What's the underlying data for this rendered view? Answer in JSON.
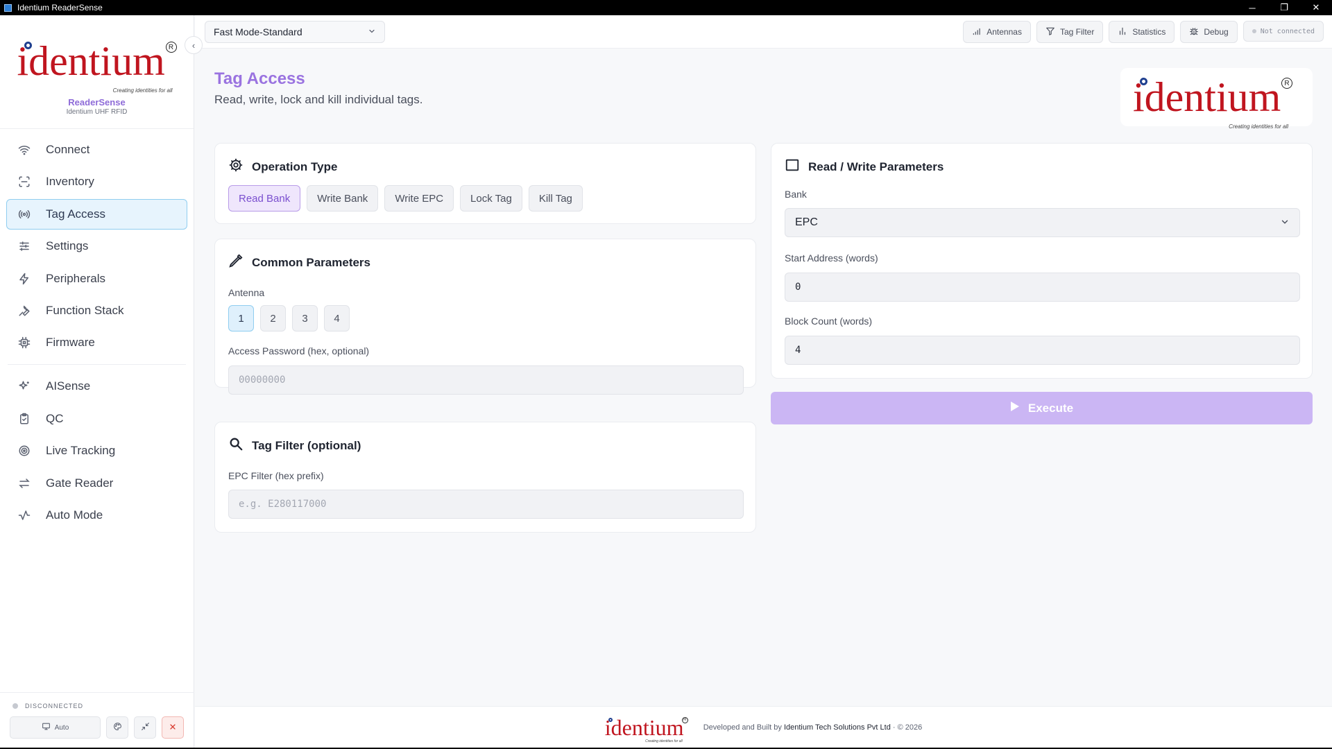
{
  "window": {
    "title": "Identium ReaderSense",
    "minimize": "─",
    "maximize": "❐",
    "close": "✕"
  },
  "sidebar": {
    "logo_text": "identium",
    "logo_tagline": "Creating identities for all",
    "logo_reg": "R",
    "app_name": "ReaderSense",
    "app_sub": "Identium UHF RFID",
    "items": [
      {
        "label": "Connect",
        "icon": "wifi-icon"
      },
      {
        "label": "Inventory",
        "icon": "scan-icon"
      },
      {
        "label": "Tag Access",
        "icon": "broadcast-icon",
        "active": true
      },
      {
        "label": "Settings",
        "icon": "sliders-icon"
      },
      {
        "label": "Peripherals",
        "icon": "bolt-icon"
      },
      {
        "label": "Function Stack",
        "icon": "wrench-icon"
      },
      {
        "label": "Firmware",
        "icon": "chip-icon"
      }
    ],
    "items2": [
      {
        "label": "AISense",
        "icon": "sparkle-icon"
      },
      {
        "label": "QC",
        "icon": "clipboard-icon"
      },
      {
        "label": "Live Tracking",
        "icon": "target-icon"
      },
      {
        "label": "Gate Reader",
        "icon": "swap-icon"
      },
      {
        "label": "Auto Mode",
        "icon": "activity-icon"
      }
    ],
    "status": "DISCONNECTED",
    "auto_label": "Auto"
  },
  "topbar": {
    "mode": "Fast Mode-Standard",
    "buttons": {
      "antennas": "Antennas",
      "tag_filter": "Tag Filter",
      "statistics": "Statistics",
      "debug": "Debug"
    },
    "connection": "Not connected"
  },
  "page": {
    "title": "Tag Access",
    "subtitle": "Read, write, lock and kill individual tags."
  },
  "operation": {
    "title": "Operation Type",
    "options": [
      "Read Bank",
      "Write Bank",
      "Write EPC",
      "Lock Tag",
      "Kill Tag"
    ],
    "selected": "Read Bank"
  },
  "common": {
    "title": "Common Parameters",
    "antenna_label": "Antenna",
    "antennas": [
      "1",
      "2",
      "3",
      "4"
    ],
    "selected_antenna": "1",
    "password_label": "Access Password (hex, optional)",
    "password_placeholder": "00000000"
  },
  "filter": {
    "title": "Tag Filter (optional)",
    "epc_label": "EPC Filter (hex prefix)",
    "epc_placeholder": "e.g. E280117000"
  },
  "rw": {
    "title": "Read / Write Parameters",
    "bank_label": "Bank",
    "bank_value": "EPC",
    "start_label": "Start Address (words)",
    "start_value": "0",
    "count_label": "Block Count (words)",
    "count_value": "4"
  },
  "execute_label": "Execute",
  "footer": {
    "prefix": "Developed and Built by",
    "company": "Identium Tech Solutions Pvt Ltd",
    "suffix": "· © 2026"
  },
  "colors": {
    "accent_purple": "#9a73e0",
    "execute_bg": "#cbb6f4",
    "active_nav": "#e7f4fd",
    "logo_red": "#c0151f"
  }
}
